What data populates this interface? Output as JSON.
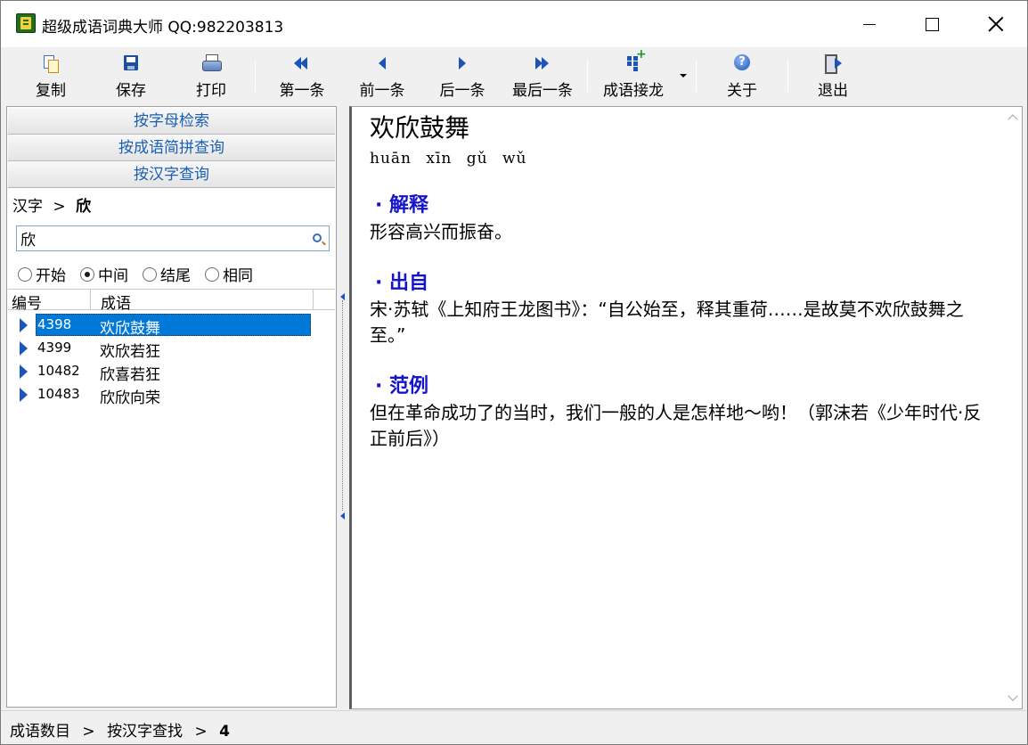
{
  "window": {
    "title": "超级成语词典大师  QQ:982203813"
  },
  "toolbar": {
    "copy": "复制",
    "save": "保存",
    "print": "打印",
    "first": "第一条",
    "prev": "前一条",
    "next": "后一条",
    "last": "最后一条",
    "chain": "成语接龙",
    "about": "关于",
    "exit": "退出"
  },
  "sidebar": {
    "search_by_letter": "按字母检索",
    "search_by_abbr": "按成语简拼查询",
    "search_by_char": "按汉字查询",
    "crumb_prefix": "汉字",
    "crumb_sep": ">",
    "crumb_current": "欣",
    "search_value": "欣",
    "radio_options": [
      {
        "label": "开始",
        "selected": false
      },
      {
        "label": "中间",
        "selected": true
      },
      {
        "label": "结尾",
        "selected": false
      },
      {
        "label": "相同",
        "selected": false
      }
    ],
    "columns": {
      "id": "编号",
      "idiom": "成语"
    },
    "rows": [
      {
        "id": "4398",
        "idiom": "欢欣鼓舞",
        "selected": true
      },
      {
        "id": "4399",
        "idiom": "欢欣若狂",
        "selected": false
      },
      {
        "id": "10482",
        "idiom": "欣喜若狂",
        "selected": false
      },
      {
        "id": "10483",
        "idiom": "欣欣向荣",
        "selected": false
      }
    ]
  },
  "detail": {
    "title": "欢欣鼓舞",
    "pinyin": "huān xīn gǔ wǔ",
    "explain_heading": "· 解释",
    "explain_text": "形容高兴而振奋。",
    "source_heading": "· 出自",
    "source_text": "宋·苏轼《上知府王龙图书》：“自公始至，释其重荷……是故莫不欢欣鼓舞之至。”",
    "example_heading": "· 范例",
    "example_text": "但在革命成功了的当时，我们一般的人是怎样地～哟！（郭沫若《少年时代·反正前后》）",
    "heading_color": "#1414c8"
  },
  "status": {
    "label": "成语数目",
    "sep1": ">",
    "mode": "按汉字查找",
    "sep2": ">",
    "count": "4"
  }
}
